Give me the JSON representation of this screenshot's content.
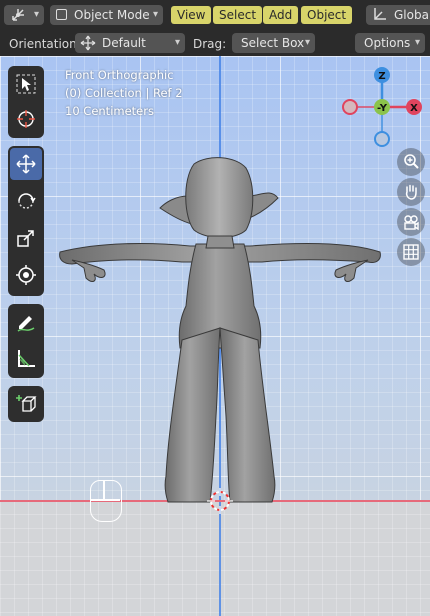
{
  "header": {
    "editor_type_icon": "transform-gizmo-icon",
    "mode_label": "Object Mode",
    "menus": [
      "View",
      "Select",
      "Add",
      "Object"
    ],
    "orientation_global": "Global"
  },
  "tool_header": {
    "orientation_label": "Orientation:",
    "orientation_value": "Default",
    "drag_label": "Drag:",
    "drag_value": "Select Box",
    "options_label": "Options"
  },
  "viewport": {
    "view_name": "Front Orthographic",
    "collection": "(0) Collection | Ref 2",
    "scale": "10 Centimeters"
  },
  "gizmo": {
    "z_label": "Z",
    "y_label": "-Y",
    "x_label": "X"
  },
  "toolbar_tools": [
    {
      "name": "select-box-tool",
      "icon": "cursor-arrow-icon"
    },
    {
      "name": "cursor-tool",
      "icon": "crosshair-icon"
    },
    {
      "name": "move-tool",
      "icon": "move-arrows-icon"
    },
    {
      "name": "rotate-tool",
      "icon": "rotate-icon"
    },
    {
      "name": "scale-tool",
      "icon": "scale-icon"
    },
    {
      "name": "transform-tool",
      "icon": "transform-icon"
    },
    {
      "name": "annotate-tool",
      "icon": "annotate-pencil-icon"
    },
    {
      "name": "measure-tool",
      "icon": "ruler-icon"
    },
    {
      "name": "add-cube-tool",
      "icon": "add-cube-icon"
    }
  ],
  "colors": {
    "menu_bg": "#d8d46a",
    "x_axis": "#e0445e",
    "y_axis": "#8bc34a",
    "z_axis": "#3d8fe0",
    "active_tool": "#4a6aa8"
  }
}
